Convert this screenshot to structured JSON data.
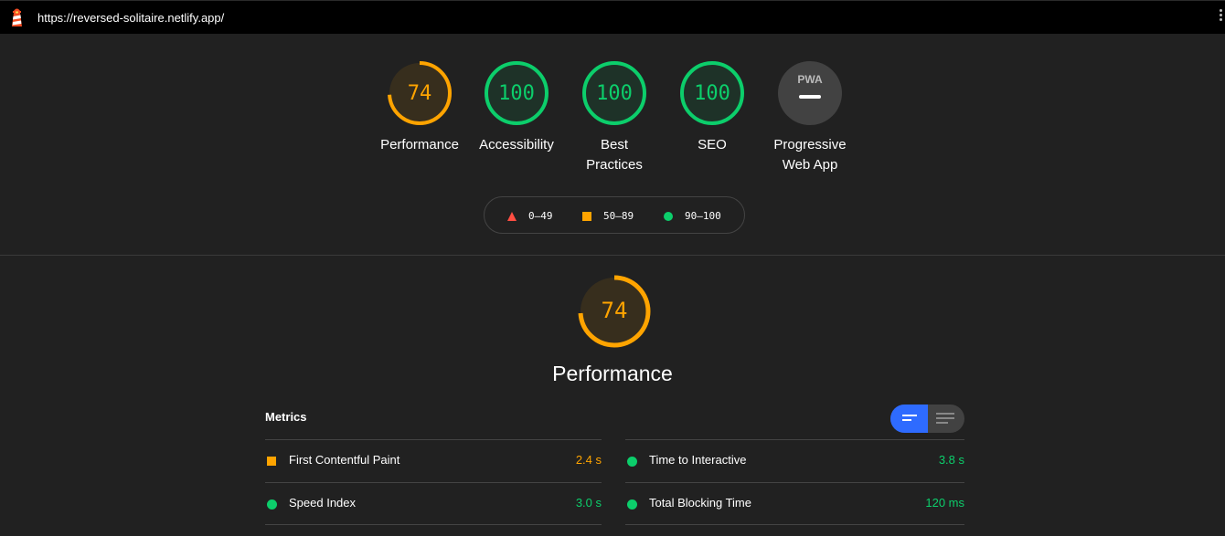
{
  "browser": {
    "url": "https://reversed-solitaire.netlify.app/"
  },
  "colors": {
    "average": "#ffa400",
    "pass": "#0cce6b",
    "fail": "#ff4e42",
    "pwa": "#aaaaaa",
    "accent": "#2e6bff"
  },
  "gauges": [
    {
      "score": "74",
      "label": "Performance",
      "level": "average",
      "fraction": 0.74
    },
    {
      "score": "100",
      "label": "Accessibility",
      "level": "pass",
      "fraction": 1.0
    },
    {
      "score": "100",
      "label": "Best Practices",
      "level": "pass",
      "fraction": 1.0
    },
    {
      "score": "100",
      "label": "SEO",
      "level": "pass",
      "fraction": 1.0
    },
    {
      "score": "",
      "label": "Progressive Web App",
      "level": "pwa",
      "badge": "PWA"
    }
  ],
  "legend": [
    {
      "icon": "triangle-icon",
      "range": "0–49",
      "level": "fail"
    },
    {
      "icon": "square-icon",
      "range": "50–89",
      "level": "average"
    },
    {
      "icon": "circle-icon",
      "range": "90–100",
      "level": "pass"
    }
  ],
  "performance": {
    "score": "74",
    "fraction": 0.74,
    "title": "Performance",
    "metrics_title": "Metrics",
    "metrics": [
      {
        "name": "First Contentful Paint",
        "value": "2.4 s",
        "level": "average"
      },
      {
        "name": "Time to Interactive",
        "value": "3.8 s",
        "level": "pass"
      },
      {
        "name": "Speed Index",
        "value": "3.0 s",
        "level": "pass"
      },
      {
        "name": "Total Blocking Time",
        "value": "120 ms",
        "level": "pass"
      }
    ]
  }
}
